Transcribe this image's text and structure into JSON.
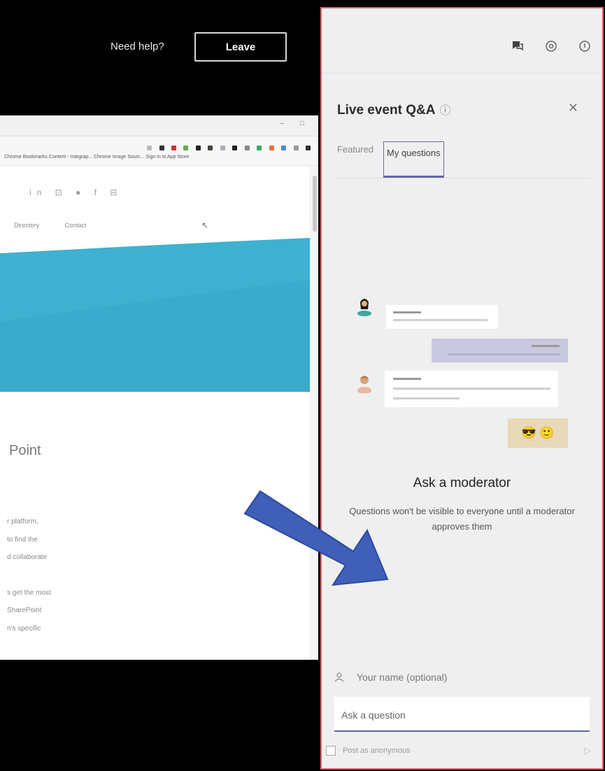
{
  "topbar": {
    "help_link": "Need help?",
    "leave_label": "Leave"
  },
  "browser": {
    "nav_items": [
      "Directory",
      "Contact"
    ],
    "heading": "Point",
    "body_lines": [
      "r platform,",
      "to find the",
      "d collaborate",
      "",
      "s get the most",
      "SharePoint",
      "n's specific"
    ],
    "bookmarks": "Chrome Bookmarks   Content - Integrap...   Chrome Image Sourc...   Sign in to App Store"
  },
  "panel": {
    "title": "Live event Q&A",
    "help_icon": "help-circle-icon",
    "tabs": [
      {
        "label": "Featured",
        "active": false
      },
      {
        "label": "My questions",
        "active": true
      }
    ],
    "empty_title": "Ask a moderator",
    "empty_desc": "Questions won't be visible to everyone until a moderator approves them",
    "name_placeholder": "Your name (optional)",
    "question_placeholder": "Ask a question",
    "anonymous_label": "Post as anonymous"
  },
  "colors": {
    "accent": "#6264a7",
    "panel_border": "#d9636b",
    "arrow": "#3f5fb8",
    "hero": "#38aece"
  }
}
